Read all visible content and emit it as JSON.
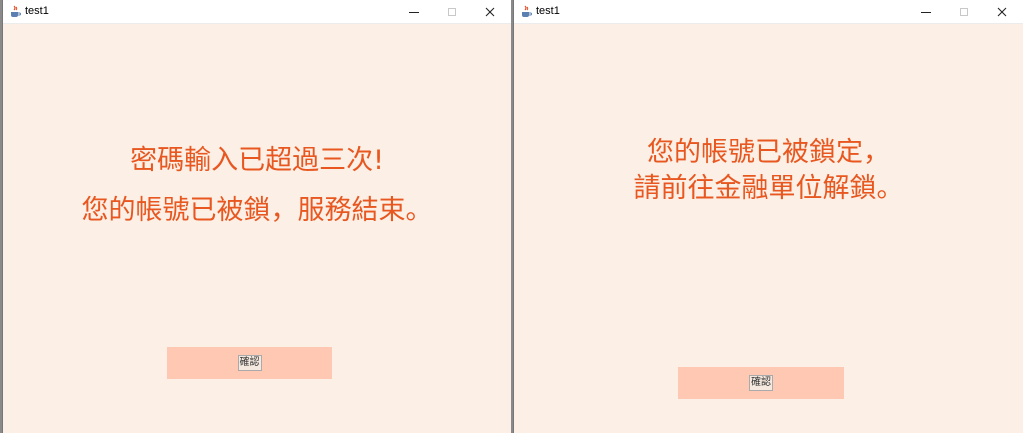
{
  "windows": [
    {
      "title": "test1",
      "message_line1": "密碼輸入已超過三次!",
      "message_line2": "您的帳號已被鎖，服務結束。",
      "confirm_label": "確認"
    },
    {
      "title": "test1",
      "message_line1": "您的帳號已被鎖定，",
      "message_line2": "請前往金融單位解鎖。",
      "confirm_label": "確認"
    }
  ],
  "icons": {
    "app": "java-cup-icon",
    "minimize": "minimize-icon",
    "maximize": "maximize-icon",
    "close": "close-icon"
  },
  "colors": {
    "window_background": "#fbefe6",
    "message_text": "#e8571f",
    "confirm_panel": "#ffc8b3"
  }
}
